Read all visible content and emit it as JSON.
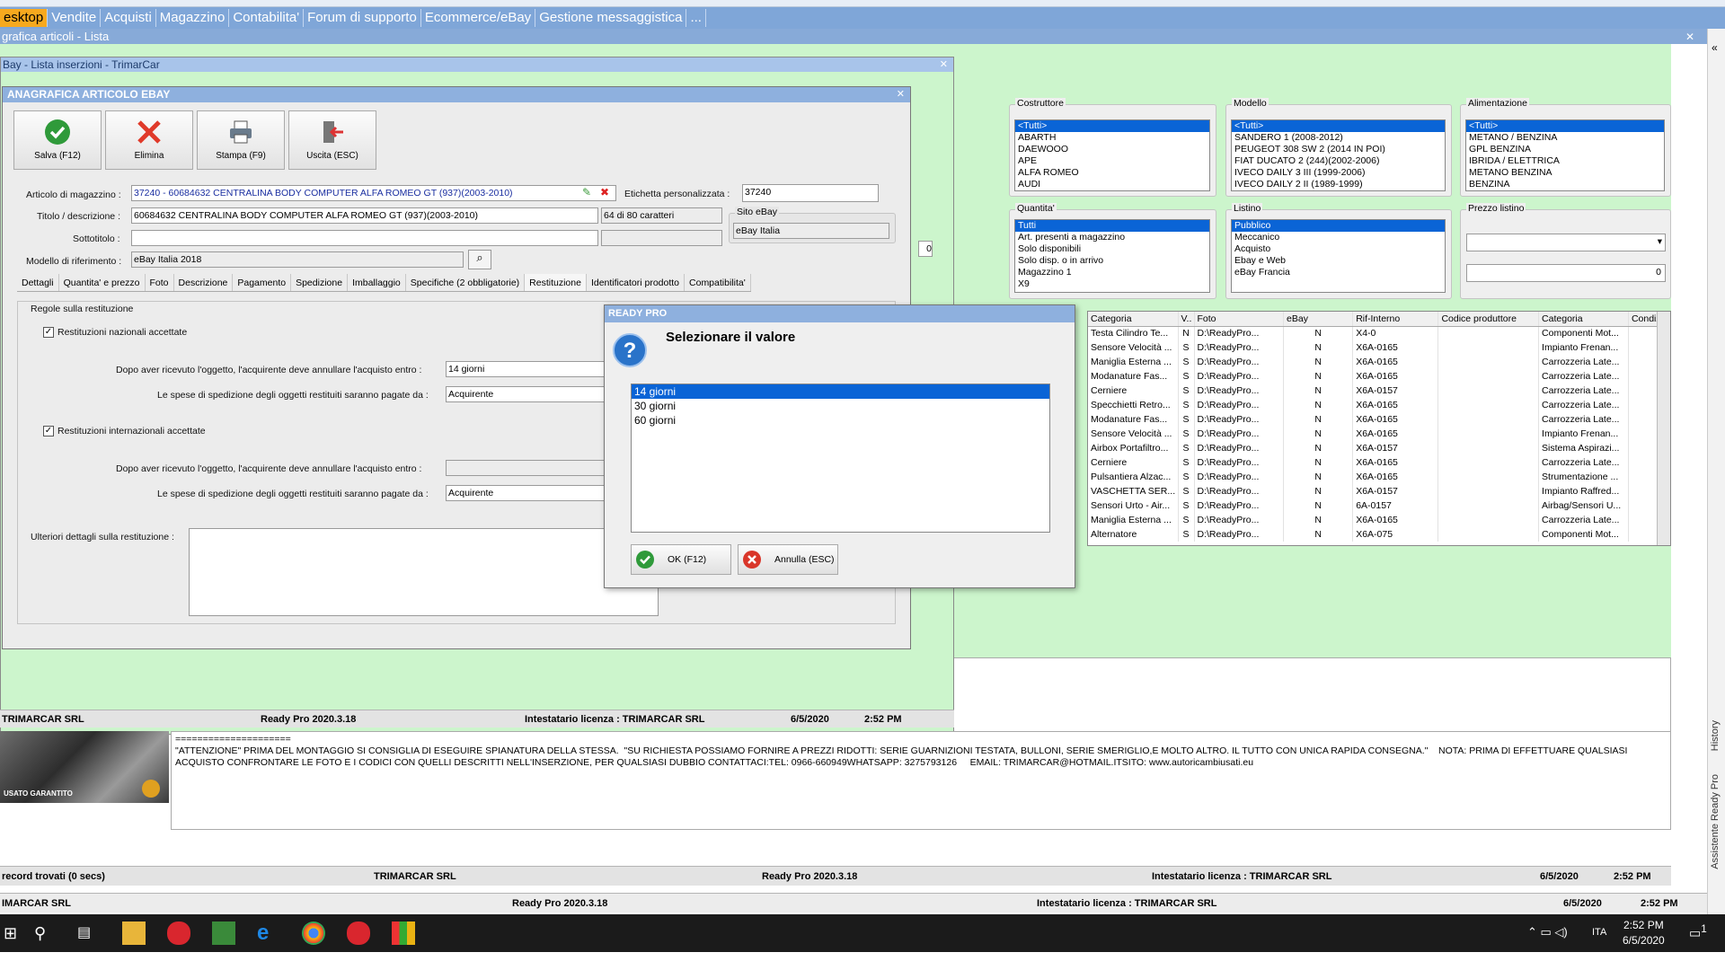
{
  "top_menu_strip": "",
  "main_tabs": [
    "esktop",
    "Vendite",
    "Acquisti",
    "Magazzino",
    "Contabilita'",
    "Forum di supporto",
    "Ecommerce/eBay",
    "Gestione messaggistica",
    "..."
  ],
  "active_tab_index": 0,
  "subtitle": "grafica articoli - Lista",
  "list_window_title": "Bay - Lista inserzioni - TrimarCar",
  "dialog": {
    "title": "ANAGRAFICA ARTICOLO EBAY",
    "toolbar": [
      {
        "label": "Salva (F12)",
        "icon": "check-icon"
      },
      {
        "label": "Elimina",
        "icon": "delete-x-icon"
      },
      {
        "label": "Stampa (F9)",
        "icon": "printer-icon"
      },
      {
        "label": "Uscita (ESC)",
        "icon": "exit-door-icon"
      }
    ],
    "articolo_label": "Articolo di magazzino :",
    "articolo_value": "37240 - 60684632 CENTRALINA BODY COMPUTER ALFA ROMEO GT (937)(2003-2010)",
    "etichetta_label": "Etichetta personalizzata :",
    "etichetta_value": "37240",
    "titolo_label": "Titolo / descrizione :",
    "titolo_value": "60684632 CENTRALINA BODY COMPUTER ALFA ROMEO GT (937)(2003-2010)",
    "char_count": "64 di 80 caratteri",
    "sito_label": "Sito eBay",
    "sito_value": "eBay Italia",
    "sottotitolo_label": "Sottotitolo :",
    "modello_label": "Modello di riferimento :",
    "modello_value": "eBay Italia 2018",
    "subtabs": [
      "Dettagli",
      "Quantita' e prezzo",
      "Foto",
      "Descrizione",
      "Pagamento",
      "Spedizione",
      "Imballaggio",
      "Specifiche (2 obbligatorie)",
      "Restituzione",
      "Identificatori prodotto",
      "Compatibilita'"
    ],
    "active_subtab": 8,
    "regole_title": "Regole sulla restituzione",
    "naz_label": "Restituzioni nazionali accettate",
    "naz_checked": true,
    "dopo_label": "Dopo aver ricevuto l'oggetto, l'acquirente deve annullare l'acquisto entro :",
    "naz_entro": "14 giorni",
    "spese_label": "Le spese di spedizione degli oggetti restituiti saranno pagate da :",
    "naz_spese": "Acquirente",
    "int_label": "Restituzioni internazionali accettate",
    "int_checked": true,
    "int_entro": "",
    "int_spese": "Acquirente",
    "ulteriori_label": "Ulteriori dettagli sulla restituzione :"
  },
  "filters": {
    "costruttore": {
      "title": "Costruttore",
      "items": [
        "<Tutti>",
        "ABARTH",
        "DAEWOOO",
        "APE",
        "ALFA ROMEO",
        "AUDI"
      ]
    },
    "modello": {
      "title": "Modello",
      "items": [
        "<Tutti>",
        "SANDERO 1 (2008-2012)",
        "PEUGEOT 308 SW 2 (2014 IN POI)",
        "FIAT DUCATO 2  (244)(2002-2006)",
        "IVECO DAILY 3 III (1999-2006)",
        "IVECO DAILY 2 II (1989-1999)"
      ]
    },
    "alimentazione": {
      "title": "Alimentazione",
      "items": [
        "<Tutti>",
        "METANO / BENZINA",
        "GPL BENZINA",
        "IBRIDA / ELETTRICA",
        "METANO BENZINA",
        "BENZINA"
      ]
    },
    "quantita": {
      "title": "Quantita'",
      "items": [
        "Tutti",
        "Art. presenti a magazzino",
        "Solo disponibili",
        "Solo disp. o in arrivo",
        "Magazzino 1",
        "X9"
      ]
    },
    "listino": {
      "title": "Listino",
      "items": [
        "Pubblico",
        "Meccanico",
        "Acquisto",
        "Ebay e Web",
        "eBay Francia"
      ]
    },
    "prezzo": {
      "title": "Prezzo listino",
      "value": "0"
    }
  },
  "left_small_value": "0",
  "grid": {
    "headers": [
      "Categoria",
      "V..",
      "Foto",
      "eBay",
      "Rif-Interno",
      "Codice produttore",
      "Categoria",
      "Condizio"
    ],
    "rows": [
      [
        "Testa Cilindro Te...",
        "N",
        "D:\\ReadyPro...",
        "N",
        "X4-0",
        "",
        "Componenti Mot...",
        ""
      ],
      [
        "Sensore Velocità ...",
        "S",
        "D:\\ReadyPro...",
        "N",
        "X6A-0165",
        "",
        "Impianto Frenan...",
        ""
      ],
      [
        "Maniglia Esterna ...",
        "S",
        "D:\\ReadyPro...",
        "N",
        "X6A-0165",
        "",
        "Carrozzeria Late...",
        ""
      ],
      [
        "Modanature Fas...",
        "S",
        "D:\\ReadyPro...",
        "N",
        "X6A-0165",
        "",
        "Carrozzeria Late...",
        ""
      ],
      [
        "Cerniere",
        "S",
        "D:\\ReadyPro...",
        "N",
        "X6A-0157",
        "",
        "Carrozzeria Late...",
        ""
      ],
      [
        "Specchietti Retro...",
        "S",
        "D:\\ReadyPro...",
        "N",
        "X6A-0165",
        "",
        "Carrozzeria Late...",
        ""
      ],
      [
        "Modanature Fas...",
        "S",
        "D:\\ReadyPro...",
        "N",
        "X6A-0165",
        "",
        "Carrozzeria Late...",
        ""
      ],
      [
        "Sensore Velocità ...",
        "S",
        "D:\\ReadyPro...",
        "N",
        "X6A-0165",
        "",
        "Impianto Frenan...",
        ""
      ],
      [
        "Airbox Portafiltro...",
        "S",
        "D:\\ReadyPro...",
        "N",
        "X6A-0157",
        "",
        "Sistema Aspirazi...",
        ""
      ],
      [
        "Cerniere",
        "S",
        "D:\\ReadyPro...",
        "N",
        "X6A-0165",
        "",
        "Carrozzeria Late...",
        ""
      ],
      [
        "Pulsantiera Alzac...",
        "S",
        "D:\\ReadyPro...",
        "N",
        "X6A-0165",
        "",
        "Strumentazione ...",
        ""
      ],
      [
        "VASCHETTA SER...",
        "S",
        "D:\\ReadyPro...",
        "N",
        "X6A-0157",
        "",
        "Impianto Raffred...",
        ""
      ],
      [
        "Sensori Urto - Air...",
        "S",
        "D:\\ReadyPro...",
        "N",
        "6A-0157",
        "",
        "Airbag/Sensori U...",
        ""
      ],
      [
        "Maniglia Esterna ...",
        "S",
        "D:\\ReadyPro...",
        "N",
        "X6A-0165",
        "",
        "Carrozzeria Late...",
        ""
      ],
      [
        "Alternatore",
        "S",
        "D:\\ReadyPro...",
        "N",
        "X6A-075",
        "",
        "Componenti Mot...",
        ""
      ]
    ]
  },
  "modal": {
    "title": "READY PRO",
    "question": "Selezionare il valore",
    "options": [
      "14 giorni",
      "30 giorni",
      "60 giorni"
    ],
    "selected_index": 0,
    "ok_label": "OK (F12)",
    "cancel_label": "Annulla (ESC)"
  },
  "status1": {
    "company": "TRIMARCAR SRL",
    "version": "Ready Pro 2020.3.18",
    "license": "Intestatario licenza : TRIMARCAR SRL",
    "date": "6/5/2020",
    "time": "2:52 PM"
  },
  "description_text": "=====================\n\"ATTENZIONE\" PRIMA DEL MONTAGGIO SI CONSIGLIA DI ESEGUIRE SPIANATURA DELLA STESSA.  \"SU RICHIESTA POSSIAMO FORNIRE A PREZZI RIDOTTI: SERIE GUARNIZIONI TESTATA, BULLONI, SERIE SMERIGLIO,E MOLTO ALTRO. IL TUTTO CON UNICA RAPIDA CONSEGNA.\"    NOTA: PRIMA DI EFFETTUARE QUALSIASI ACQUISTO CONFRONTARE LE FOTO E I CODICI CON QUELLI DESCRITTI NELL'INSERZIONE, PER QUALSIASI DUBBIO CONTATTACI:TEL: 0966-660949WHATSAPP: 3275793126     EMAIL: TRIMARCAR@HOTMAIL.ITSITO: www.autoricambiusati.eu",
  "thumb_caption": "USATO GARANTITO",
  "status2": {
    "records": "record trovati (0 secs)",
    "company": "TRIMARCAR SRL",
    "version": "Ready Pro 2020.3.18",
    "license": "Intestatario licenza : TRIMARCAR SRL",
    "date": "6/5/2020",
    "time": "2:52 PM"
  },
  "status3": {
    "company": "IMARCAR SRL",
    "version": "Ready Pro 2020.3.18",
    "license": "Intestatario licenza : TRIMARCAR SRL",
    "date": "6/5/2020",
    "time": "2:52 PM"
  },
  "right_panel": {
    "history": "History",
    "assistant": "Assistente Ready Pro",
    "collapse": "«"
  },
  "taskbar": {
    "time": "2:52 PM",
    "date": "6/5/2020",
    "lang": "ITA",
    "notif": "1"
  }
}
